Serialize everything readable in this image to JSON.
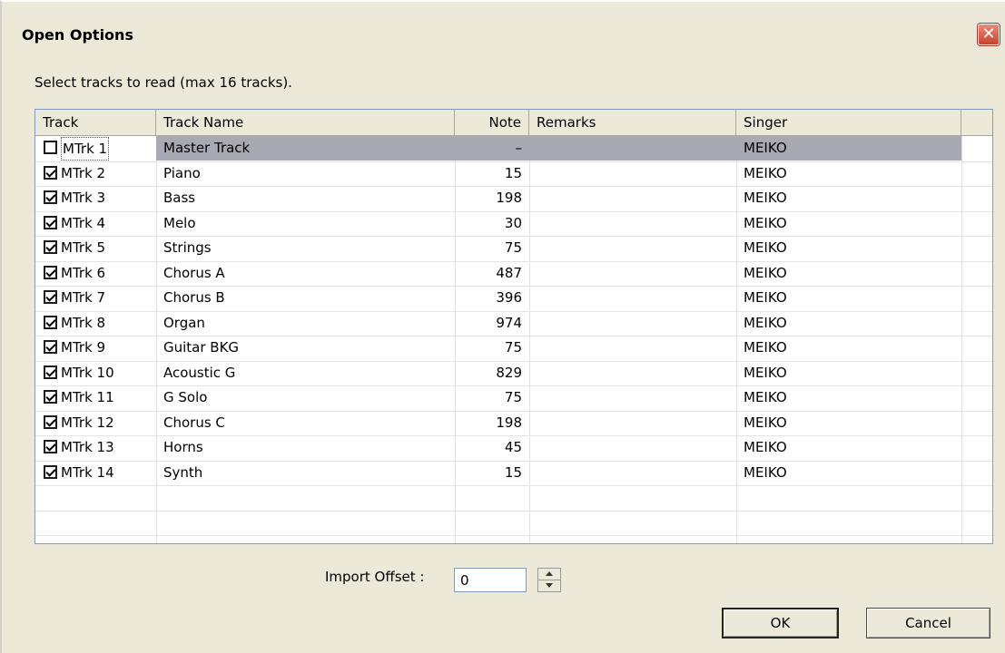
{
  "window": {
    "title": "Open Options",
    "close_glyph": "✕"
  },
  "instruction": "Select tracks to read (max 16 tracks).",
  "columns": {
    "track": "Track",
    "track_name": "Track Name",
    "note": "Note",
    "remarks": "Remarks",
    "singer": "Singer"
  },
  "tracks": [
    {
      "checked": false,
      "track": "MTrk 1",
      "name": "Master Track",
      "note": "–",
      "remarks": "",
      "singer": "MEIKO",
      "selected": true
    },
    {
      "checked": true,
      "track": "MTrk 2",
      "name": "Piano",
      "note": "15",
      "remarks": "",
      "singer": "MEIKO"
    },
    {
      "checked": true,
      "track": "MTrk 3",
      "name": "Bass",
      "note": "198",
      "remarks": "",
      "singer": "MEIKO"
    },
    {
      "checked": true,
      "track": "MTrk 4",
      "name": "Melo",
      "note": "30",
      "remarks": "",
      "singer": "MEIKO"
    },
    {
      "checked": true,
      "track": "MTrk 5",
      "name": "Strings",
      "note": "75",
      "remarks": "",
      "singer": "MEIKO"
    },
    {
      "checked": true,
      "track": "MTrk 6",
      "name": "Chorus A",
      "note": "487",
      "remarks": "",
      "singer": "MEIKO"
    },
    {
      "checked": true,
      "track": "MTrk 7",
      "name": "Chorus B",
      "note": "396",
      "remarks": "",
      "singer": "MEIKO"
    },
    {
      "checked": true,
      "track": "MTrk 8",
      "name": "Organ",
      "note": "974",
      "remarks": "",
      "singer": "MEIKO"
    },
    {
      "checked": true,
      "track": "MTrk 9",
      "name": "Guitar BKG",
      "note": "75",
      "remarks": "",
      "singer": "MEIKO"
    },
    {
      "checked": true,
      "track": "MTrk 10",
      "name": "Acoustic G",
      "note": "829",
      "remarks": "",
      "singer": "MEIKO"
    },
    {
      "checked": true,
      "track": "MTrk 11",
      "name": "G Solo",
      "note": "75",
      "remarks": "",
      "singer": "MEIKO"
    },
    {
      "checked": true,
      "track": "MTrk 12",
      "name": "Chorus C",
      "note": "198",
      "remarks": "",
      "singer": "MEIKO"
    },
    {
      "checked": true,
      "track": "MTrk 13",
      "name": "Horns",
      "note": "45",
      "remarks": "",
      "singer": "MEIKO"
    },
    {
      "checked": true,
      "track": "MTrk 14",
      "name": "Synth",
      "note": "15",
      "remarks": "",
      "singer": "MEIKO"
    }
  ],
  "import_offset": {
    "label": "Import Offset :",
    "value": "0"
  },
  "buttons": {
    "ok": "OK",
    "cancel": "Cancel"
  },
  "colors": {
    "dialog_bg": "#ece9d8",
    "selected_row": "#a9a9b3",
    "close_button": "#d9583f"
  }
}
